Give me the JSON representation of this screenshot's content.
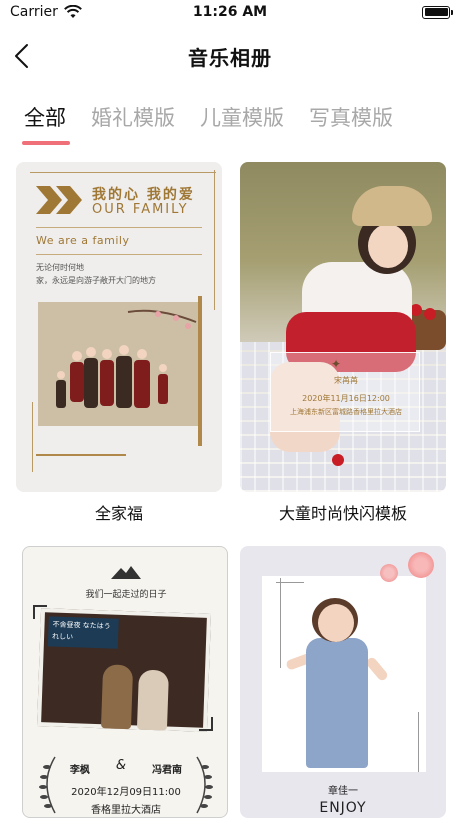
{
  "status_bar": {
    "carrier": "Carrier",
    "time": "11:26 AM"
  },
  "nav": {
    "title": "音乐相册"
  },
  "tabs": [
    {
      "label": "全部",
      "active": true
    },
    {
      "label": "婚礼模版",
      "active": false
    },
    {
      "label": "儿童模版",
      "active": false
    },
    {
      "label": "写真模版",
      "active": false
    }
  ],
  "templates": [
    {
      "label": "全家福",
      "thumb": {
        "title_cn": "我的心 我的爱",
        "title_en": "OUR FAMILY",
        "subtitle": "We are a family",
        "line1": "无论何时何地",
        "line2": "家，永远是向游子敞开大门的地方"
      }
    },
    {
      "label": "大童时尚快闪模板",
      "thumb": {
        "name": "宋苒苒",
        "date": "2020年11月16日12:00",
        "place": "上海浦东新区富城路香格里拉大酒店"
      }
    },
    {
      "label": "",
      "thumb": {
        "header": "我们一起走过的日子",
        "sign": "不舍昼夜 なたはうれしい",
        "name_left": "李枫",
        "amp": "&",
        "name_right": "冯君南",
        "date": "2020年12月09日11:00",
        "place": "香格里拉大酒店"
      }
    },
    {
      "label": "",
      "thumb": {
        "name": "章佳一",
        "caption": "ENJOY"
      }
    }
  ],
  "colors": {
    "accent": "#f0707a",
    "gold": "#a07836",
    "inactive_tab": "#a8a8a8"
  }
}
